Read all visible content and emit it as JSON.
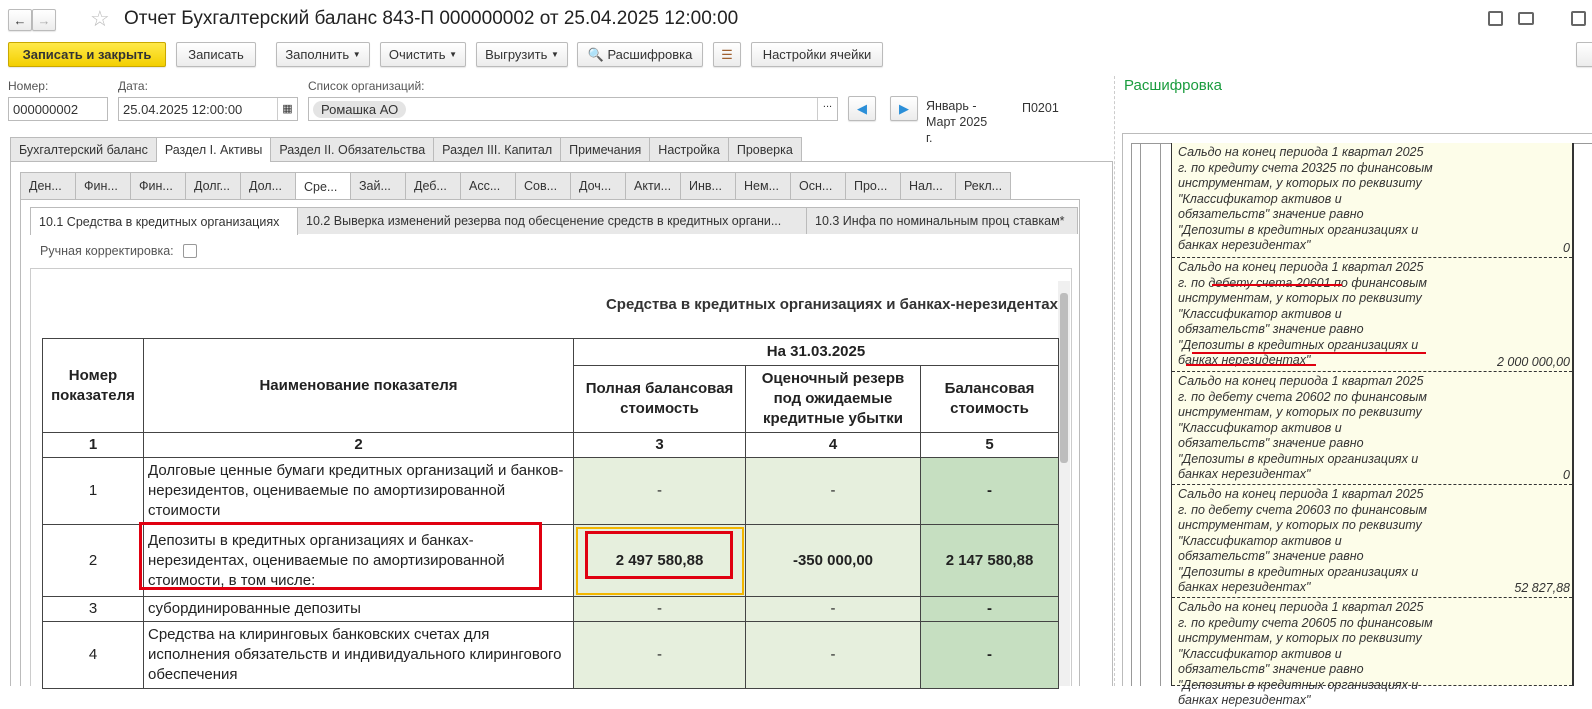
{
  "title": "Отчет Бухгалтерский баланс 843-П 000000002 от 25.04.2025 12:00:00",
  "toolbar": {
    "save_close": "Записать и закрыть",
    "save": "Записать",
    "fill": "Заполнить",
    "clear": "Очистить",
    "export": "Выгрузить",
    "decode": "Расшифровка",
    "cell_settings": "Настройки ячейки"
  },
  "fields": {
    "number_label": "Номер:",
    "number": "000000002",
    "date_label": "Дата:",
    "date": "25.04.2025 12:00:00",
    "orgs_label": "Список организаций:",
    "org": "Ромашка АО",
    "period": "Январь - Март 2025 г.",
    "code": "П0201"
  },
  "tabs1": [
    "Бухгалтерский баланс",
    "Раздел I. Активы",
    "Раздел II. Обязательства",
    "Раздел III. Капитал",
    "Примечания",
    "Настройка",
    "Проверка"
  ],
  "tabs2": [
    "Ден...",
    "Фин...",
    "Фин...",
    "Долг...",
    "Дол...",
    "Сре...",
    "Зай...",
    "Деб...",
    "Асс...",
    "Сов...",
    "Доч...",
    "Акти...",
    "Инв...",
    "Нем...",
    "Осн...",
    "Про...",
    "Нал...",
    "Рекл..."
  ],
  "tabs3": [
    "10.1 Средства в кредитных организациях",
    "10.2 Выверка изменений резерва под обесценение средств в кредитных органи...",
    "10.3 Инфа по номинальным проц ставкам*"
  ],
  "manual": "Ручная корректировка:",
  "table": {
    "title": "Средства в кредитных организациях и банках-нерезидентах",
    "h_num": "Номер показателя",
    "h_name": "Наименование показателя",
    "h_date": "На 31.03.2025",
    "h3": "Полная балансовая стоимость",
    "h4": "Оценочный резерв под ожидаемые кредитные убытки",
    "h5": "Балансовая стоимость",
    "colnums": [
      "1",
      "2",
      "3",
      "4",
      "5"
    ],
    "rows": [
      {
        "n": "1",
        "name": "Долговые ценные бумаги кредитных организаций и банков-нерезидентов, оцениваемые по амортизированной стоимости",
        "c3": "-",
        "c4": "-",
        "c5": "-"
      },
      {
        "n": "2",
        "name": "Депозиты в кредитных организациях и банках-нерезидентах, оцениваемые по амортизированной стоимости, в том числе:",
        "c3": "2 497 580,88",
        "c4": "-350 000,00",
        "c5": "2 147 580,88"
      },
      {
        "n": "3",
        "name": "субординированные депозиты",
        "c3": "-",
        "c4": "-",
        "c5": "-"
      },
      {
        "n": "4",
        "name": "Средства на клиринговых банковских счетах для исполнения обязательств и индивидуального клирингового обеспечения",
        "c3": "-",
        "c4": "-",
        "c5": "-"
      }
    ]
  },
  "decode": {
    "title": "Расшифровка",
    "title_color": "#1a9c3e",
    "entries": [
      {
        "text": "Сальдо на конец периода 1 квартал 2025 г. по кредиту счета 20325 по финансовым инструментам, у которых по реквизиту \"Классификатор активов и обязательств\" значение равно \"Депозиты в кредитных организациях и банках нерезидентах\"",
        "value": "0"
      },
      {
        "text": "Сальдо на конец периода 1 квартал 2025 г. по дебету счета 20601 по финансовым инструментам, у которых по реквизиту \"Классификатор активов и обязательств\" значение равно \"Депозиты в кредитных организациях и банках нерезидентах\"",
        "value": "2 000 000,00"
      },
      {
        "text": "Сальдо на конец периода 1 квартал 2025 г. по дебету счета 20602 по финансовым инструментам, у которых по реквизиту \"Классификатор активов и обязательств\" значение равно \"Депозиты в кредитных организациях и банках нерезидентах\"",
        "value": "0"
      },
      {
        "text": "Сальдо на конец периода 1 квартал 2025 г. по дебету счета 20603 по финансовым инструментам, у которых по реквизиту \"Классификатор активов и обязательств\" значение равно \"Депозиты в кредитных организациях и банках нерезидентах\"",
        "value": "52 827,88"
      },
      {
        "text": "Сальдо на конец периода 1 квартал 2025 г. по кредиту счета 20605 по финансовым инструментам, у которых по реквизиту \"Классификатор активов и обязательств\" значение равно \"Депозиты в кредитных организациях и банках нерезидентах\"",
        "value": ""
      }
    ]
  }
}
